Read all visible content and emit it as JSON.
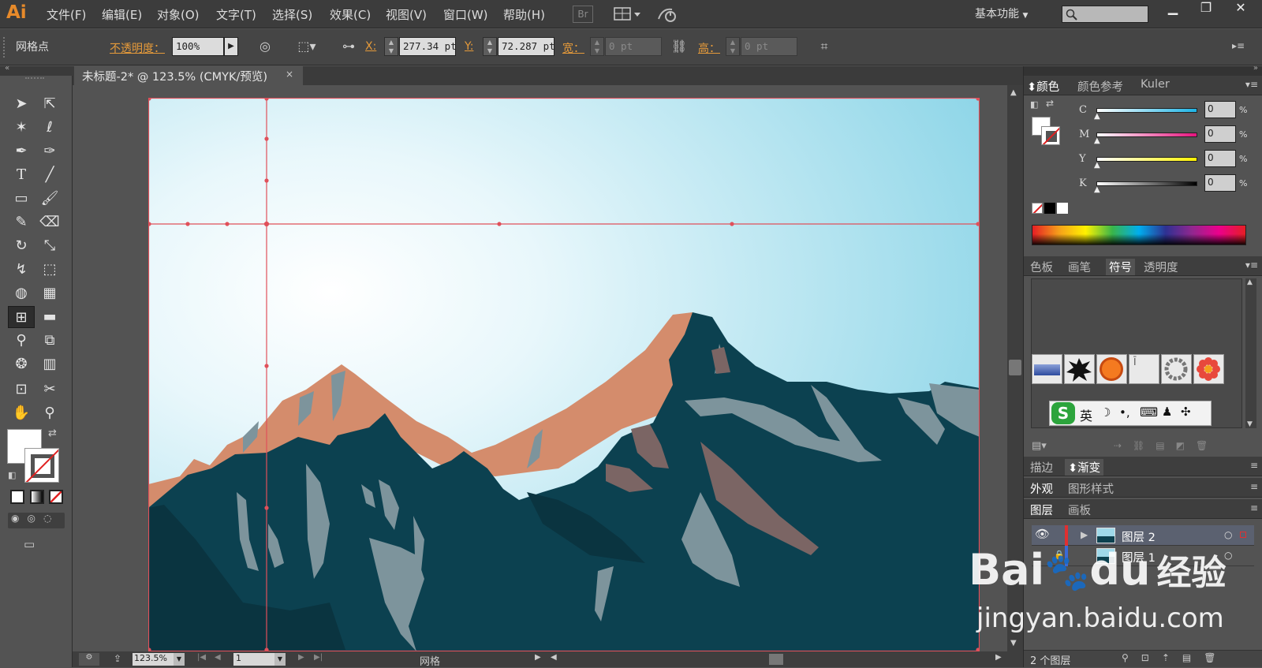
{
  "app": {
    "logo": "Ai",
    "menus": [
      "文件(F)",
      "编辑(E)",
      "对象(O)",
      "文字(T)",
      "选择(S)",
      "效果(C)",
      "视图(V)",
      "窗口(W)",
      "帮助(H)"
    ],
    "bridge_label": "Br",
    "workspace": "基本功能",
    "search_placeholder": ""
  },
  "control_bar": {
    "selection_type": "网格点",
    "opacity_label": "不透明度：",
    "opacity_value": "100%",
    "x_label": "X:",
    "x_value": "277.34 pt",
    "y_label": "Y:",
    "y_value": "72.287 pt",
    "width_label": "宽：",
    "width_value": "0 pt",
    "height_label": "高：",
    "height_value": "0 pt"
  },
  "document": {
    "tab_title": "未标题-2* @ 123.5% (CMYK/预览)",
    "tab_close": "×",
    "sky_color_top": "#8fd6e8",
    "sky_color_center": "#ffffff",
    "mountain_dark": "#0c4150",
    "mountain_lit": "#d48c6c",
    "rock_gray": "#7d949c",
    "rock_brown": "#7b6564",
    "mesh_color": "#e0505a"
  },
  "status": {
    "zoom": "123.5%",
    "page": "1",
    "tool_name": "网格"
  },
  "panels": {
    "color": {
      "tabs": [
        "颜色",
        "颜色参考",
        "Kuler"
      ],
      "channels": [
        {
          "label": "C",
          "value": "0",
          "unit": "%"
        },
        {
          "label": "M",
          "value": "0",
          "unit": "%"
        },
        {
          "label": "Y",
          "value": "0",
          "unit": "%"
        },
        {
          "label": "K",
          "value": "0",
          "unit": "%"
        }
      ]
    },
    "symbols": {
      "tabs": [
        "色板",
        "画笔",
        "符号",
        "透明度"
      ]
    },
    "ime_bar": {
      "logo": "S",
      "mode": "英",
      "icons": [
        "moon-icon",
        "punctuation-icon",
        "keyboard-icon",
        "user-icon",
        "grid-icon"
      ]
    },
    "stroke_gradient_tabs": [
      "描边",
      "渐变"
    ],
    "appearance_tabs": [
      "外观",
      "图形样式"
    ],
    "layers": {
      "tabs": [
        "图层",
        "画板"
      ],
      "items": [
        {
          "name": "图层 2",
          "color": "#e03030"
        },
        {
          "name": "图层 1",
          "color": "#3a6ad8"
        }
      ],
      "footer": "2 个图层"
    }
  },
  "watermark": {
    "brand": "Bai",
    "brand2": "du",
    "cn": "经验",
    "url": "jingyan.baidu.com"
  }
}
